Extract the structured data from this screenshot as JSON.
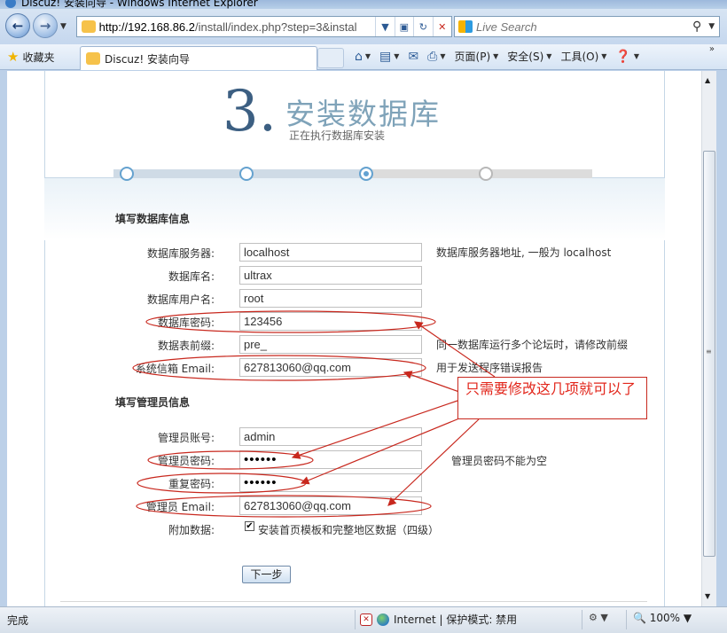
{
  "window": {
    "title": "Discuz! 安装向导 - Windows Internet Explorer"
  },
  "address": {
    "url_host": "http://192.168.86.2",
    "url_path": "/install/index.php?step=3&instal",
    "search_placeholder": "Live Search"
  },
  "toolbar": {
    "favorites_label": "收藏夹",
    "tab_title": "Discuz! 安装向导",
    "page_label": "页面(P)",
    "safety_label": "安全(S)",
    "tools_label": "工具(O)",
    "chevron": "»"
  },
  "page": {
    "step_number": "3.",
    "step_title": "安装数据库",
    "step_subtitle": "正在执行数据库安装",
    "progress": {
      "total_steps": 4,
      "current_step": 3
    },
    "db_section_title": "填写数据库信息",
    "admin_section_title": "填写管理员信息",
    "db_fields": [
      {
        "label": "数据库服务器:",
        "value": "localhost",
        "hint": "数据库服务器地址, 一般为 localhost"
      },
      {
        "label": "数据库名:",
        "value": "ultrax",
        "hint": ""
      },
      {
        "label": "数据库用户名:",
        "value": "root",
        "hint": ""
      },
      {
        "label": "数据库密码:",
        "value": "123456",
        "hint": ""
      },
      {
        "label": "数据表前缀:",
        "value": "pre_",
        "hint": "同一数据库运行多个论坛时，请修改前缀"
      },
      {
        "label": "系统信箱 Email:",
        "value": "627813060@qq.com",
        "hint": "用于发送程序错误报告"
      }
    ],
    "admin_fields": [
      {
        "label": "管理员账号:",
        "value": "admin",
        "hint": ""
      },
      {
        "label": "管理员密码:",
        "value": "••••••",
        "hint": "管理员密码不能为空"
      },
      {
        "label": "重复密码:",
        "value": "••••••",
        "hint": ""
      },
      {
        "label": "管理员 Email:",
        "value": "627813060@qq.com",
        "hint": ""
      }
    ],
    "extra_label": "附加数据:",
    "extra_checkbox_label": "安装首页模板和完整地区数据（四级）",
    "extra_checked": true,
    "next_button": "下一步",
    "annotation_text": "只需要修改这几项就可以了",
    "annotation_color": "#e2261b"
  },
  "status": {
    "text": "完成",
    "zone": "Internet | 保护模式: 禁用",
    "zoom": "100%"
  }
}
